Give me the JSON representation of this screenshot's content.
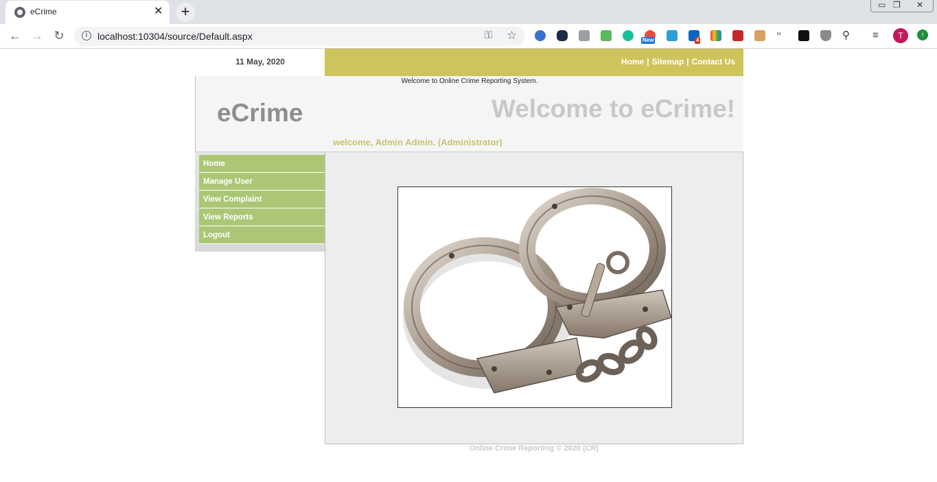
{
  "browser": {
    "tab_title": "eCrime",
    "url": "localhost:10304/source/Default.aspx",
    "avatar_letter": "T",
    "ext_new_badge": "New",
    "ext_count_badge": "4"
  },
  "site": {
    "date": "11 May, 2020",
    "top_links": [
      "Home",
      "Sitemap",
      "Contact Us"
    ],
    "header_message": "Welcome to Online Crime Reporting System.",
    "logo": "eCrime",
    "welcome_heading": "Welcome to eCrime!",
    "welcome_user": "welcome, Admin Admin. (Administrator)",
    "menu": [
      "Home",
      "Manage User",
      "View Complaint",
      "View Reports",
      "Logout"
    ],
    "footer": "Online Crime Reporting © 2020 (CR)"
  },
  "colors": {
    "topbar": "#cdc45b",
    "menu_item": "#abc776",
    "welcome_user": "#c9c273"
  }
}
